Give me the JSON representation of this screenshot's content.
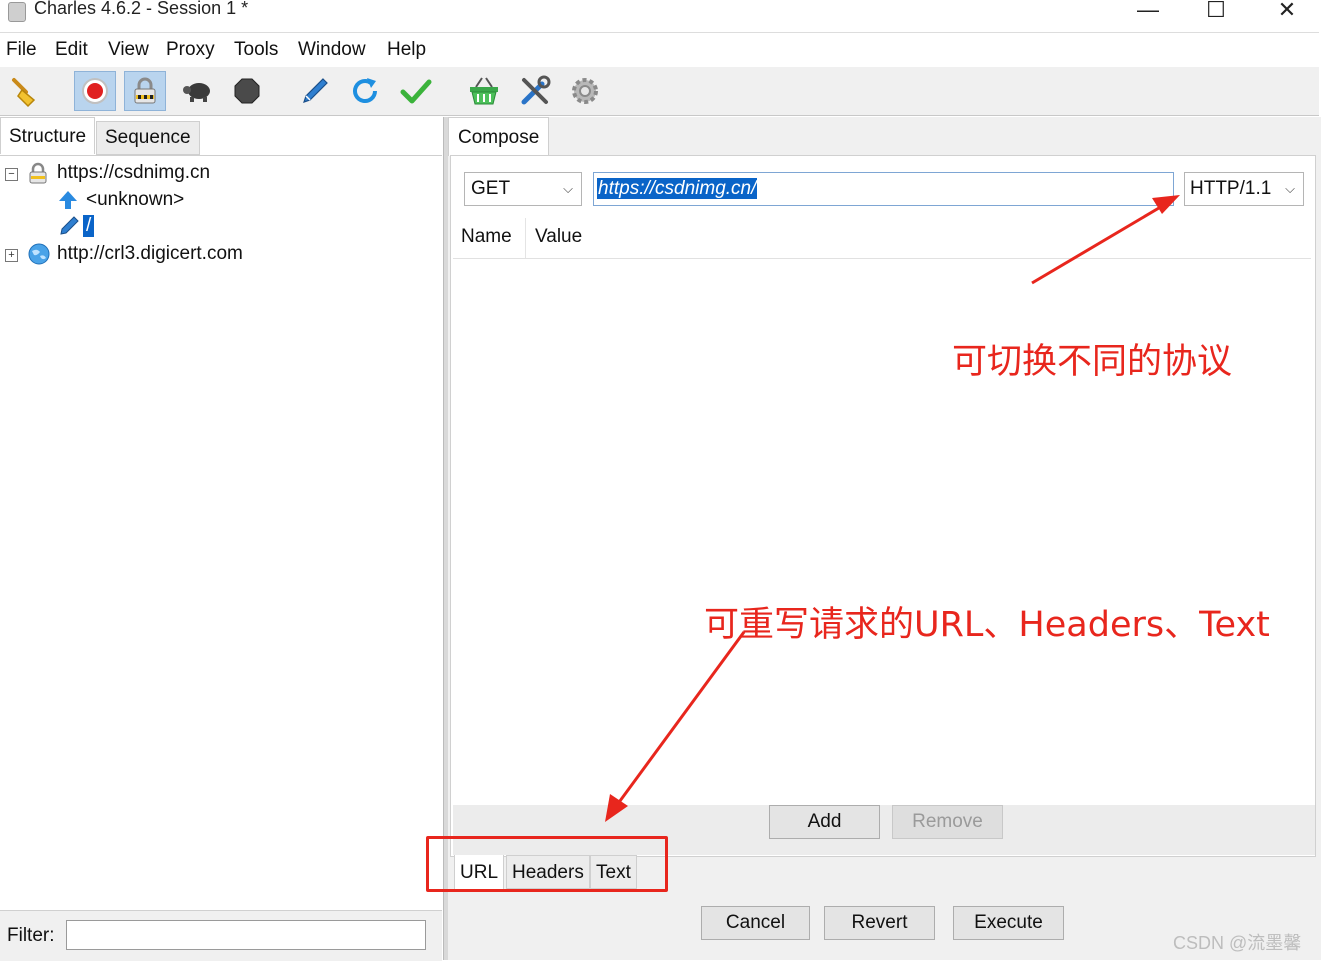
{
  "window": {
    "title": "Charles 4.6.2 - Session 1 *",
    "controls": [
      "—",
      "☐",
      "✕"
    ]
  },
  "menu": [
    "File",
    "Edit",
    "View",
    "Proxy",
    "Tools",
    "Window",
    "Help"
  ],
  "toolbar": {
    "icons": [
      "broom-icon",
      "record-icon",
      "ssl-proxy-lock-icon",
      "throttle-turtle-icon",
      "breakpoint-stop-icon",
      "compose-pen-icon",
      "repeat-refresh-icon",
      "validate-check-icon",
      "shopping-basket-icon",
      "tools-icon",
      "settings-gear-icon"
    ],
    "active": [
      "record-icon",
      "ssl-proxy-lock-icon"
    ]
  },
  "left": {
    "tabs": {
      "structure": "Structure",
      "sequence": "Sequence"
    },
    "tree": {
      "host1": "https://csdnimg.cn",
      "host1_child1": "<unknown>",
      "host1_child2": "/",
      "host2": "http://crl3.digicert.com"
    },
    "filter_label": "Filter:",
    "filter_value": ""
  },
  "compose": {
    "tab": "Compose",
    "method": "GET",
    "url": "https://csdnimg.cn/",
    "protocol": "HTTP/1.1",
    "columns": {
      "name": "Name",
      "value": "Value"
    },
    "add": "Add",
    "remove": "Remove",
    "bottom_tabs": {
      "url": "URL",
      "headers": "Headers",
      "text": "Text"
    },
    "cancel": "Cancel",
    "revert": "Revert",
    "execute": "Execute"
  },
  "annotations": {
    "protocol_note": "可切换不同的协议",
    "rewrite_note": "可重写请求的URL、Headers、Text",
    "color": "#e8261d"
  },
  "watermark": "CSDN @流墨馨"
}
